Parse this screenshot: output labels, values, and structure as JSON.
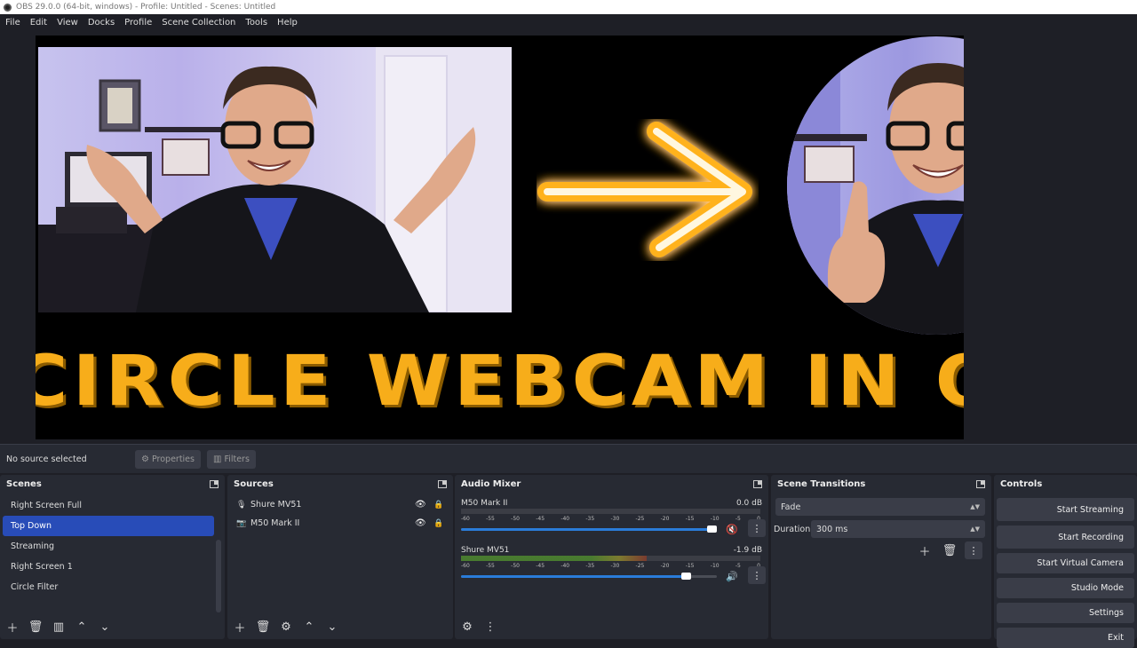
{
  "window": {
    "title": "OBS 29.0.0 (64-bit, windows) - Profile: Untitled - Scenes: Untitled"
  },
  "menu": [
    "File",
    "Edit",
    "View",
    "Docks",
    "Profile",
    "Scene Collection",
    "Tools",
    "Help"
  ],
  "preview": {
    "headline": "CIRCLE WEBCAM IN OBS",
    "arrow_color": "#ffb21c",
    "headline_color": "#f7ad1a"
  },
  "statusrow": {
    "no_source": "No source selected",
    "properties": "Properties",
    "filters": "Filters"
  },
  "scenes": {
    "title": "Scenes",
    "items": [
      "Right Screen Full",
      "Top Down",
      "Streaming",
      "Right Screen 1",
      "Circle Filter"
    ],
    "selected_index": 1
  },
  "sources": {
    "title": "Sources",
    "items": [
      {
        "name": "Shure MV51",
        "icon": "microphone-icon"
      },
      {
        "name": "M50 Mark II",
        "icon": "camera-icon"
      }
    ]
  },
  "mixer": {
    "title": "Audio Mixer",
    "channels": [
      {
        "name": "M50 Mark II",
        "db": "0.0 dB",
        "volume": 1.0,
        "meter": 0.0,
        "muted": true
      },
      {
        "name": "Shure MV51",
        "db": "-1.9 dB",
        "volume": 0.9,
        "meter": 0.62,
        "muted": false
      }
    ],
    "ticks": [
      "-60",
      "-55",
      "-50",
      "-45",
      "-40",
      "-35",
      "-30",
      "-25",
      "-20",
      "-15",
      "-10",
      "-5",
      "0"
    ]
  },
  "transitions": {
    "title": "Scene Transitions",
    "selected": "Fade",
    "duration_label": "Duration",
    "duration_value": "300 ms"
  },
  "controls": {
    "title": "Controls",
    "buttons": [
      "Start Streaming",
      "Start Recording",
      "Start Virtual Camera",
      "Studio Mode",
      "Settings",
      "Exit"
    ]
  }
}
